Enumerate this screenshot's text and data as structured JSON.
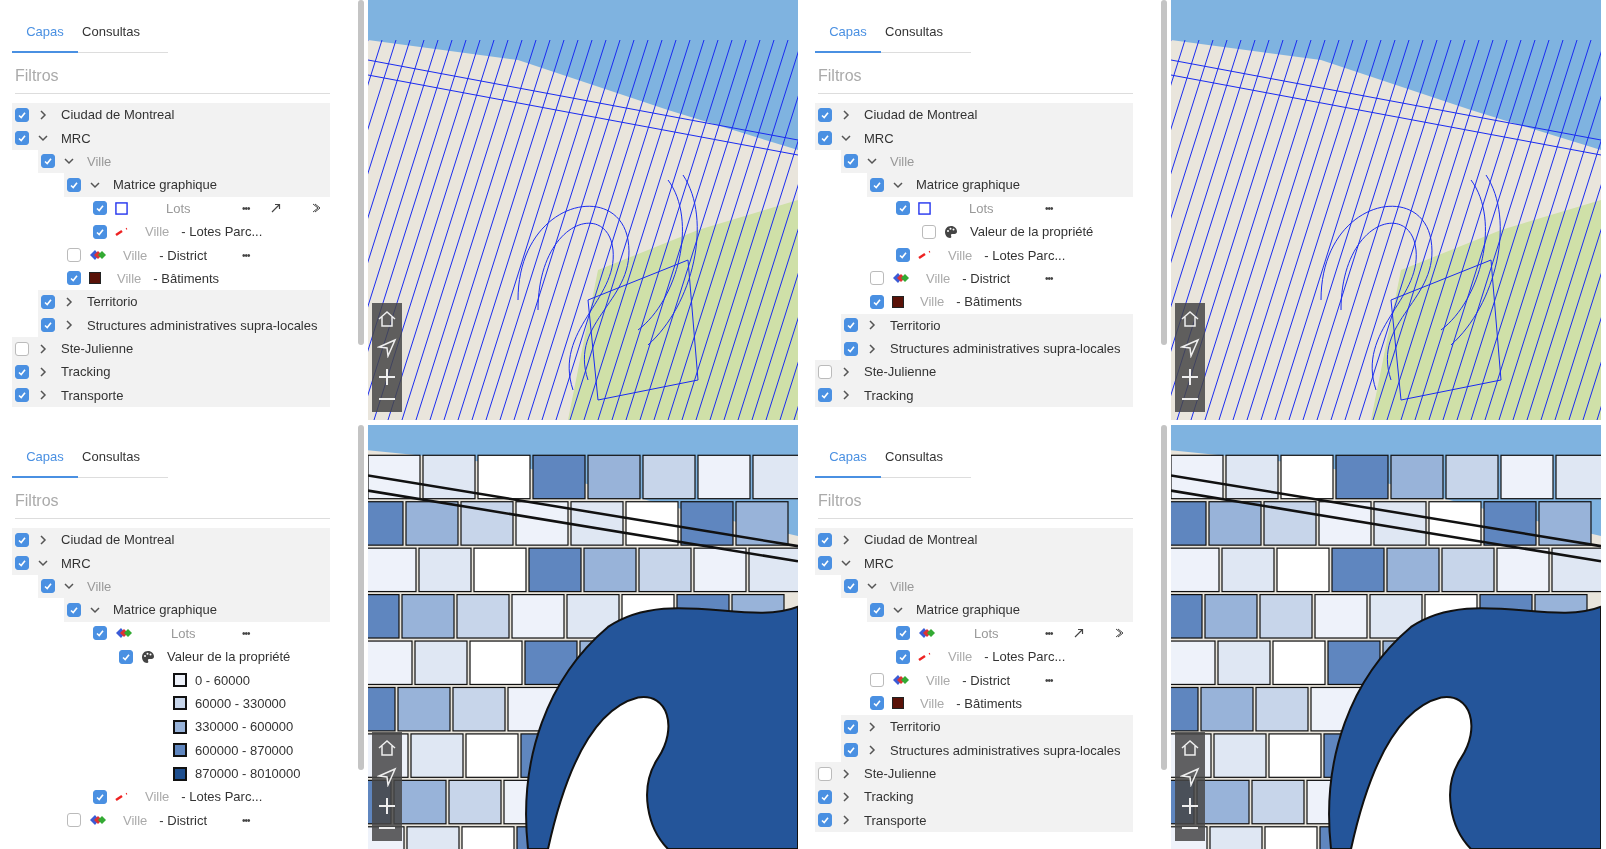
{
  "panels": [
    {
      "tabs": [
        {
          "label": "Capas",
          "selected": true
        },
        {
          "label": "Consultas",
          "selected": false
        }
      ],
      "filter_label": "Filtros",
      "map": {
        "kind": "lines"
      },
      "tree": [
        {
          "kind": "group",
          "label": "Ciudad de Montreal",
          "checked": true,
          "expanded": false
        },
        {
          "kind": "group",
          "label": "MRC",
          "checked": true,
          "expanded": true,
          "children": [
            {
              "kind": "group",
              "label": "Ville",
              "muted": true,
              "checked": true,
              "expanded": true,
              "children": [
                {
                  "kind": "group",
                  "label": "Matrice graphique",
                  "checked": true,
                  "expanded": true,
                  "children": [
                    {
                      "kind": "layer",
                      "symbol": {
                        "kind": "outline"
                      },
                      "label": "Lots",
                      "muted": true,
                      "checked": true,
                      "menu": "•••",
                      "tools": true
                    },
                    {
                      "kind": "layer",
                      "symbol": {
                        "kind": "line"
                      },
                      "prefix": "Ville",
                      "label": "- Lotes Parc...",
                      "checked": true
                    }
                  ]
                },
                {
                  "kind": "layer",
                  "symbol": {
                    "kind": "multi"
                  },
                  "prefix": "Ville",
                  "label": "- District",
                  "checked": false,
                  "menu": "•••"
                },
                {
                  "kind": "layer",
                  "symbol": {
                    "kind": "fill",
                    "color": "#5a1208"
                  },
                  "prefix": "Ville",
                  "label": "- Bâtiments",
                  "checked": true
                }
              ]
            },
            {
              "kind": "group",
              "label": "Territorio",
              "checked": true,
              "expanded": false
            },
            {
              "kind": "group",
              "label": "Structures administratives supra-locales",
              "checked": true,
              "expanded": false
            }
          ]
        },
        {
          "kind": "group",
          "label": "Ste-Julienne",
          "checked": false,
          "expanded": false
        },
        {
          "kind": "group",
          "label": "Tracking",
          "checked": true,
          "expanded": false
        },
        {
          "kind": "group",
          "label": "Transporte",
          "checked": true,
          "expanded": false
        }
      ]
    },
    {
      "tabs": [
        {
          "label": "Capas",
          "selected": true
        },
        {
          "label": "Consultas",
          "selected": false
        }
      ],
      "filter_label": "Filtros",
      "map": {
        "kind": "lines"
      },
      "tree": [
        {
          "kind": "group",
          "label": "Ciudad de Montreal",
          "checked": true,
          "expanded": false
        },
        {
          "kind": "group",
          "label": "MRC",
          "checked": true,
          "expanded": true,
          "children": [
            {
              "kind": "group",
              "label": "Ville",
              "muted": true,
              "checked": true,
              "expanded": true,
              "children": [
                {
                  "kind": "group",
                  "label": "Matrice graphique",
                  "checked": true,
                  "expanded": true,
                  "children": [
                    {
                      "kind": "layer",
                      "symbol": {
                        "kind": "outline"
                      },
                      "label": "Lots",
                      "muted": true,
                      "checked": true,
                      "menu": "•••",
                      "children": [
                        {
                          "kind": "style",
                          "label": "Valeur de la propriété",
                          "checked": false
                        }
                      ]
                    },
                    {
                      "kind": "layer",
                      "symbol": {
                        "kind": "line"
                      },
                      "prefix": "Ville",
                      "label": "- Lotes Parc...",
                      "checked": true
                    }
                  ]
                },
                {
                  "kind": "layer",
                  "symbol": {
                    "kind": "multi"
                  },
                  "prefix": "Ville",
                  "label": "- District",
                  "checked": false,
                  "menu": "•••"
                },
                {
                  "kind": "layer",
                  "symbol": {
                    "kind": "fill",
                    "color": "#5a1208"
                  },
                  "prefix": "Ville",
                  "label": "- Bâtiments",
                  "checked": true
                }
              ]
            },
            {
              "kind": "group",
              "label": "Territorio",
              "checked": true,
              "expanded": false
            },
            {
              "kind": "group",
              "label": "Structures administratives supra-locales",
              "checked": true,
              "expanded": false
            }
          ]
        },
        {
          "kind": "group",
          "label": "Ste-Julienne",
          "checked": false,
          "expanded": false
        },
        {
          "kind": "group",
          "label": "Tracking",
          "checked": true,
          "expanded": false
        }
      ]
    },
    {
      "tabs": [
        {
          "label": "Capas",
          "selected": true
        },
        {
          "label": "Consultas",
          "selected": false
        }
      ],
      "filter_label": "Filtros",
      "map": {
        "kind": "choropleth"
      },
      "tree": [
        {
          "kind": "group",
          "label": "Ciudad de Montreal",
          "checked": true,
          "expanded": false
        },
        {
          "kind": "group",
          "label": "MRC",
          "checked": true,
          "expanded": true,
          "children": [
            {
              "kind": "group",
              "label": "Ville",
              "muted": true,
              "checked": true,
              "expanded": true,
              "children": [
                {
                  "kind": "group",
                  "label": "Matrice graphique",
                  "checked": true,
                  "expanded": true,
                  "children": [
                    {
                      "kind": "layer",
                      "symbol": {
                        "kind": "multi"
                      },
                      "label": "Lots",
                      "muted": true,
                      "checked": true,
                      "menu": "•••",
                      "children": [
                        {
                          "kind": "style",
                          "label": "Valeur de la propriété",
                          "checked": true,
                          "children": [
                            {
                              "kind": "class",
                              "label": "0 - 60000",
                              "color": "#eef2fa"
                            },
                            {
                              "kind": "class",
                              "label": "60000 - 330000",
                              "color": "#c7d5ea"
                            },
                            {
                              "kind": "class",
                              "label": "330000 - 600000",
                              "color": "#98b3d9"
                            },
                            {
                              "kind": "class",
                              "label": "600000 - 870000",
                              "color": "#5f86bf"
                            },
                            {
                              "kind": "class",
                              "label": "870000 - 8010000",
                              "color": "#1f4f8f"
                            }
                          ]
                        }
                      ]
                    },
                    {
                      "kind": "layer",
                      "symbol": {
                        "kind": "line"
                      },
                      "prefix": "Ville",
                      "label": "- Lotes Parc...",
                      "checked": true
                    }
                  ]
                },
                {
                  "kind": "layer",
                  "symbol": {
                    "kind": "multi"
                  },
                  "prefix": "Ville",
                  "label": "- District",
                  "checked": false,
                  "menu": "•••"
                }
              ]
            }
          ]
        }
      ]
    },
    {
      "tabs": [
        {
          "label": "Capas",
          "selected": true
        },
        {
          "label": "Consultas",
          "selected": false
        }
      ],
      "filter_label": "Filtros",
      "map": {
        "kind": "choropleth"
      },
      "tree": [
        {
          "kind": "group",
          "label": "Ciudad de Montreal",
          "checked": true,
          "expanded": false
        },
        {
          "kind": "group",
          "label": "MRC",
          "checked": true,
          "expanded": true,
          "children": [
            {
              "kind": "group",
              "label": "Ville",
              "muted": true,
              "checked": true,
              "expanded": true,
              "children": [
                {
                  "kind": "group",
                  "label": "Matrice graphique",
                  "checked": true,
                  "expanded": true,
                  "children": [
                    {
                      "kind": "layer",
                      "symbol": {
                        "kind": "multi"
                      },
                      "label": "Lots",
                      "muted": true,
                      "checked": true,
                      "menu": "•••",
                      "tools": true
                    },
                    {
                      "kind": "layer",
                      "symbol": {
                        "kind": "line"
                      },
                      "prefix": "Ville",
                      "label": "- Lotes Parc...",
                      "checked": true
                    }
                  ]
                },
                {
                  "kind": "layer",
                  "symbol": {
                    "kind": "multi"
                  },
                  "prefix": "Ville",
                  "label": "- District",
                  "checked": false,
                  "menu": "•••"
                },
                {
                  "kind": "layer",
                  "symbol": {
                    "kind": "fill",
                    "color": "#5a1208"
                  },
                  "prefix": "Ville",
                  "label": "- Bâtiments",
                  "checked": true
                }
              ]
            },
            {
              "kind": "group",
              "label": "Territorio",
              "checked": true,
              "expanded": false
            },
            {
              "kind": "group",
              "label": "Structures administratives supra-locales",
              "checked": true,
              "expanded": false
            }
          ]
        },
        {
          "kind": "group",
          "label": "Ste-Julienne",
          "checked": false,
          "expanded": false
        },
        {
          "kind": "group",
          "label": "Tracking",
          "checked": true,
          "expanded": false
        },
        {
          "kind": "group",
          "label": "Transporte",
          "checked": true,
          "expanded": false
        }
      ]
    }
  ]
}
